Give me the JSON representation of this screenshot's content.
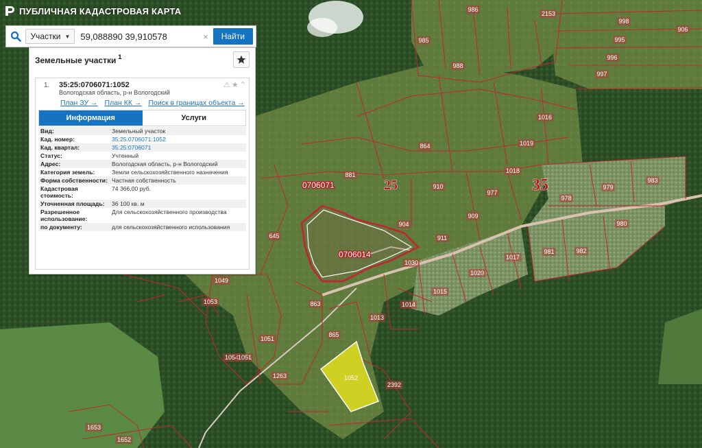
{
  "app": {
    "title": "ПУБЛИЧНАЯ КАДАСТРОВАЯ КАРТА"
  },
  "search": {
    "type_label": "Участки",
    "value": "59,088890 39,910578",
    "clear_symbol": "×",
    "button_label": "Найти"
  },
  "panel": {
    "title": "Земельные участки",
    "count": "1",
    "card": {
      "index": "1.",
      "cad_number": "35:25:0706071:1052",
      "address": "Вологодская область, р-н Вологодский",
      "links": [
        "План ЗУ →",
        "План КК →",
        "Поиск в границах объекта →"
      ],
      "tabs": [
        "Информация",
        "Услуги"
      ],
      "rows": [
        {
          "key": "Вид:",
          "value": "Земельный участок"
        },
        {
          "key": "Кад. номер:",
          "value": "35:25:0706071:1052"
        },
        {
          "key": "Кад. квартал:",
          "value": "35:25:0706071"
        },
        {
          "key": "Статус:",
          "value": "Учтенный"
        },
        {
          "key": "Адрес:",
          "value": "Вологодская область, р-н Вологодский"
        },
        {
          "key": "Категория земель:",
          "value": "Земли сельскохозяйственного назначения"
        },
        {
          "key": "Форма собственности:",
          "value": "Частная собственность"
        },
        {
          "key": "Кадастровая стоимость:",
          "value": "74 366,00 руб."
        },
        {
          "key": "Уточненная площадь:",
          "value": "36 100 кв. м"
        },
        {
          "key": "Разрешенное использование:",
          "value": "Для сельскохозяйственного производства"
        },
        {
          "key": "по документу:",
          "value": "для сельскохозяйственного использования"
        }
      ]
    }
  },
  "map": {
    "colors": {
      "forest": "#2c4f28",
      "field": "#5e7a3a",
      "boundary": "#c0272d",
      "highlight": "#e6e01a"
    },
    "block_labels": [
      "0706071",
      "0706014"
    ],
    "quarter_labels": [
      "25",
      "35"
    ],
    "parcels": [
      "986",
      "998",
      "906",
      "985",
      "2153",
      "995",
      "996",
      "988",
      "997",
      "1016",
      "864",
      "1019",
      "1018",
      "881",
      "910",
      "977",
      "983",
      "979",
      "978",
      "645",
      "904",
      "911",
      "909",
      "980",
      "981",
      "982",
      "1017",
      "1020",
      "1015",
      "1014",
      "1030",
      "1049",
      "1053",
      "863",
      "1013",
      "1051",
      "1263",
      "865",
      "1052",
      "2392",
      "1653",
      "1652",
      "1054",
      "1051"
    ]
  }
}
